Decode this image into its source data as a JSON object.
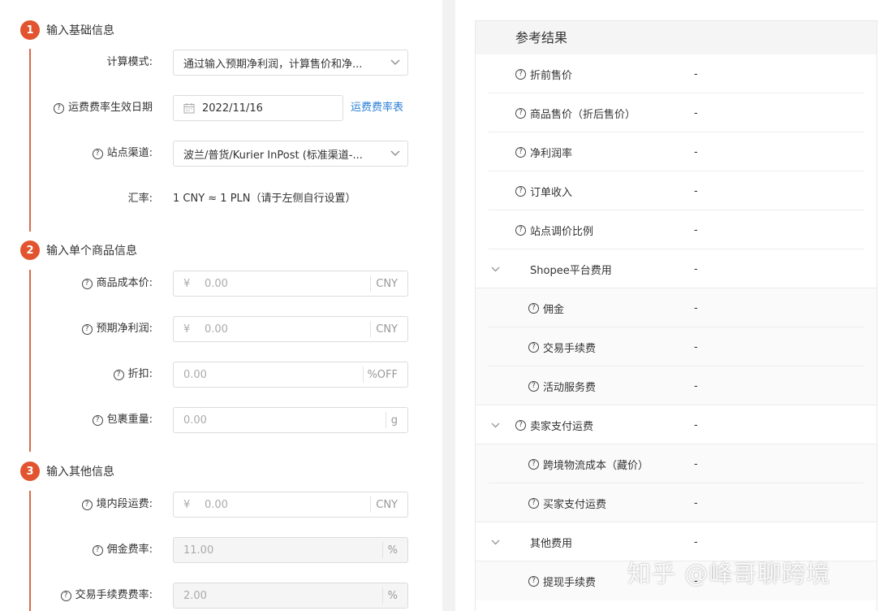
{
  "steps": [
    {
      "num": "1",
      "title": "输入基础信息"
    },
    {
      "num": "2",
      "title": "输入单个商品信息"
    },
    {
      "num": "3",
      "title": "输入其他信息"
    }
  ],
  "basic": {
    "calc_mode_label": "计算模式:",
    "calc_mode_value": "通过输入预期净利润，计算售价和净...",
    "rate_date_label": "运费费率生效日期",
    "rate_date_value": "2022/11/16",
    "rate_table_link": "运费费率表",
    "channel_label": "站点渠道:",
    "channel_value": "波兰/普货/Kurier InPost (标准渠道-...",
    "fx_label": "汇率:",
    "fx_value": "1 CNY ≈ 1 PLN（请于左侧自行设置）"
  },
  "product": {
    "cost_label": "商品成本价:",
    "cost_prefix": "¥",
    "cost_placeholder": "0.00",
    "cost_unit": "CNY",
    "profit_label": "预期净利润:",
    "profit_prefix": "¥",
    "profit_placeholder": "0.00",
    "profit_unit": "CNY",
    "discount_label": "折扣:",
    "discount_placeholder": "0.00",
    "discount_unit": "%OFF",
    "weight_label": "包裹重量:",
    "weight_placeholder": "0.00",
    "weight_unit": "g"
  },
  "other": {
    "domestic_label": "境内段运费:",
    "domestic_prefix": "¥",
    "domestic_placeholder": "0.00",
    "domestic_unit": "CNY",
    "commission_label": "佣金费率:",
    "commission_value": "11.00",
    "commission_unit": "%",
    "txfee_label": "交易手续费费率:",
    "txfee_value": "2.00",
    "txfee_unit": "%"
  },
  "result": {
    "title": "参考结果",
    "rows": [
      {
        "label": "折前售价",
        "value": "-"
      },
      {
        "label": "商品售价（折后售价）",
        "value": "-"
      },
      {
        "label": "净利润率",
        "value": "-"
      },
      {
        "label": "订单收入",
        "value": "-"
      },
      {
        "label": "站点调价比例",
        "value": "-"
      },
      {
        "label": "Shopee平台费用",
        "value": "-"
      },
      {
        "label": "佣金",
        "value": "-"
      },
      {
        "label": "交易手续费",
        "value": "-"
      },
      {
        "label": "活动服务费",
        "value": "-"
      },
      {
        "label": "卖家支付运费",
        "value": "-"
      },
      {
        "label": "跨境物流成本（藏价）",
        "value": "-"
      },
      {
        "label": "买家支付运费",
        "value": "-"
      },
      {
        "label": "其他费用",
        "value": "-"
      },
      {
        "label": "提现手续费",
        "value": "-"
      }
    ]
  },
  "watermark": "知乎 @峰哥聊跨境"
}
